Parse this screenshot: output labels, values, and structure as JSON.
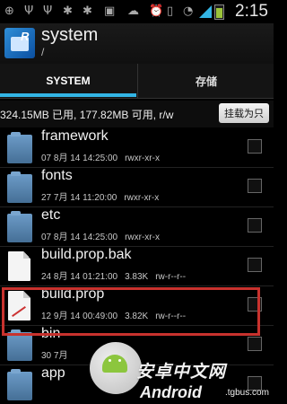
{
  "status_bar": {
    "time": "2:15",
    "icons": [
      "add-icon",
      "usb-icon",
      "usb-icon",
      "android-debug-icon",
      "android-debug-icon",
      "app-notification-icon",
      "cloud-icon",
      "alarm-icon",
      "vibrate-icon",
      "wifi-icon",
      "signal-icon",
      "battery-icon"
    ]
  },
  "header": {
    "title": "system",
    "path": "/"
  },
  "tabs": [
    {
      "label": "SYSTEM",
      "active": true
    },
    {
      "label": "存储",
      "active": false
    }
  ],
  "info_bar": {
    "text": "324.15MB 已用, 177.82MB 可用, r/w",
    "mount_button": "挂载为只"
  },
  "files": [
    {
      "name": "framework",
      "date": "07 8月 14 14:25:00",
      "size": "",
      "perms": "rwxr-xr-x",
      "type": "folder"
    },
    {
      "name": "fonts",
      "date": "27 7月 14 11:20:00",
      "size": "",
      "perms": "rwxr-xr-x",
      "type": "folder"
    },
    {
      "name": "etc",
      "date": "07 8月 14 14:25:00",
      "size": "",
      "perms": "rwxr-xr-x",
      "type": "folder"
    },
    {
      "name": "build.prop.bak",
      "date": "24 8月 14 01:21:00",
      "size": "3.83K",
      "perms": "rw-r--r--",
      "type": "file"
    },
    {
      "name": "build.prop",
      "date": "12 9月 14 00:49:00",
      "size": "3.82K",
      "perms": "rw-r--r--",
      "type": "file"
    },
    {
      "name": "bin",
      "date": "30 7月",
      "size": "",
      "perms": "",
      "type": "folder"
    },
    {
      "name": "app",
      "date": "",
      "size": "",
      "perms": "",
      "type": "folder"
    }
  ],
  "watermark": {
    "cn": "安卓中文网",
    "en": "Android",
    "domain": ".tgbus.com"
  },
  "colors": {
    "accent": "#33b5e5",
    "highlight": "#c8322e"
  }
}
